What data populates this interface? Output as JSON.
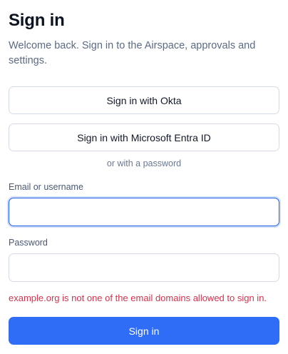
{
  "header": {
    "title": "Sign in",
    "subtitle": "Welcome back. Sign in to the Airspace, approvals and settings."
  },
  "sso": {
    "okta_label": "Sign in with Okta",
    "entra_label": "Sign in with Microsoft Entra ID"
  },
  "divider": {
    "text": "or with a password"
  },
  "form": {
    "email_label": "Email or username",
    "email_value": "",
    "password_label": "Password",
    "password_value": "",
    "error_message": "example.org is not one of the email domains allowed to sign in.",
    "submit_label": "Sign in"
  },
  "colors": {
    "accent": "#2f6df6",
    "focus_ring": "#2563eb",
    "error": "#d1344f",
    "muted_text": "#5b6b84"
  }
}
